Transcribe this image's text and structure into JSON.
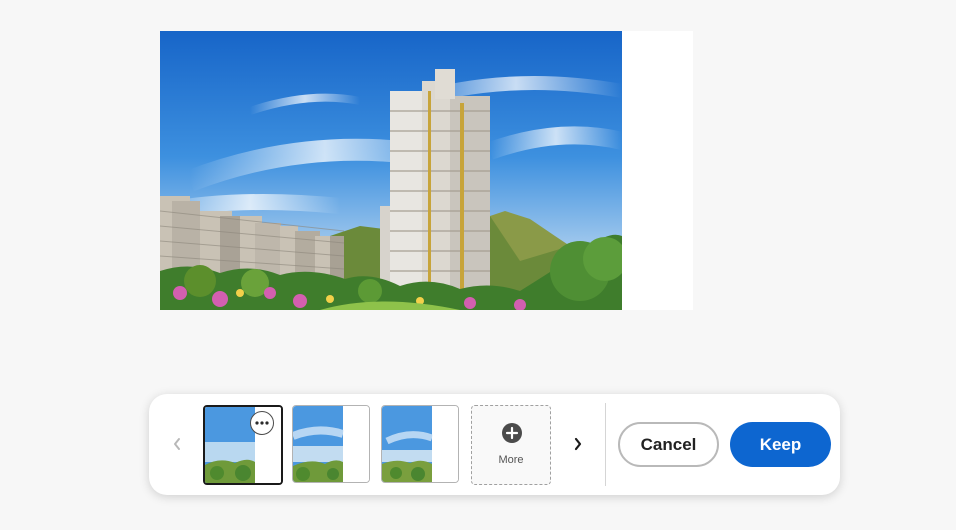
{
  "canvas": {
    "image_alt": "High-rise residential towers with hills and gardens under blue sky",
    "transparent_strip": true
  },
  "toolbar": {
    "prev_icon": "chevron-left-icon",
    "next_icon": "chevron-right-icon",
    "thumbnails": [
      {
        "variant": "Variation 1",
        "selected": true,
        "options_icon": "more-horizontal-icon"
      },
      {
        "variant": "Variation 2",
        "selected": false
      },
      {
        "variant": "Variation 3",
        "selected": false
      }
    ],
    "more_label": "More",
    "more_icon": "plus-circle-icon",
    "cancel_label": "Cancel",
    "keep_label": "Keep"
  },
  "colors": {
    "page_bg": "#f7f7f7",
    "accent": "#0d66d0",
    "sky": "#2a7fd6"
  }
}
